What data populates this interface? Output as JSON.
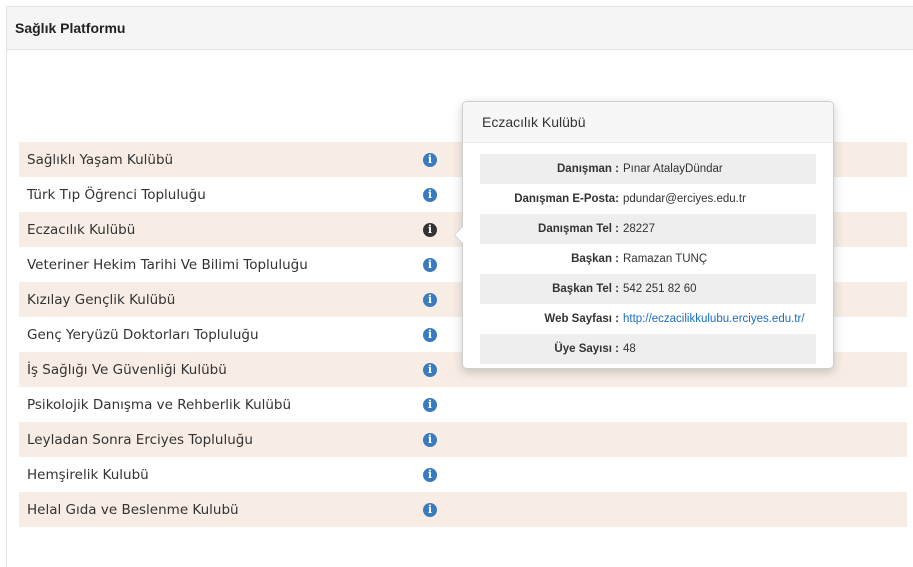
{
  "panel": {
    "title": "Sağlık Platformu"
  },
  "clubs": [
    {
      "label": "Sağlıklı Yaşam Kulübü"
    },
    {
      "label": "Türk Tıp Öğrenci Topluluğu"
    },
    {
      "label": "Eczacılık Kulübü"
    },
    {
      "label": "Veteriner Hekim Tarihi Ve Bilimi Topluluğu"
    },
    {
      "label": "Kızılay Gençlik Kulübü"
    },
    {
      "label": "Genç Yeryüzü Doktorları Topluluğu"
    },
    {
      "label": "İş Sağlığı Ve Güvenliği Kulübü"
    },
    {
      "label": "Psikolojik Danışma ve Rehberlik Kulübü"
    },
    {
      "label": "Leyladan Sonra Erciyes Topluluğu"
    },
    {
      "label": "Hemşirelik Kulubü"
    },
    {
      "label": "Helal Gıda ve Beslenme Kulubü"
    }
  ],
  "info_icon": {
    "glyph": "i",
    "icon_name": "info-circle-icon",
    "color": "#3a7bbf",
    "active_color": "#333333"
  },
  "popover": {
    "title": "Eczacılık Kulübü",
    "rows": [
      {
        "key": "Danışman :",
        "value": "Pınar AtalayDündar"
      },
      {
        "key": "Danışman E-Posta:",
        "value": "pdundar@erciyes.edu.tr"
      },
      {
        "key": "Danışman Tel :",
        "value": "28227"
      },
      {
        "key": "Başkan :",
        "value": "Ramazan TUNÇ"
      },
      {
        "key": "Başkan Tel :",
        "value": "542 251 82 60"
      },
      {
        "key": "Web Sayfası :",
        "value": "http://eczacilikkulubu.erciyes.edu.tr/"
      },
      {
        "key": "Üye Sayısı :",
        "value": "48"
      }
    ]
  },
  "colors": {
    "row_shade": "#f7ede4",
    "link": "#1a6fc4"
  }
}
